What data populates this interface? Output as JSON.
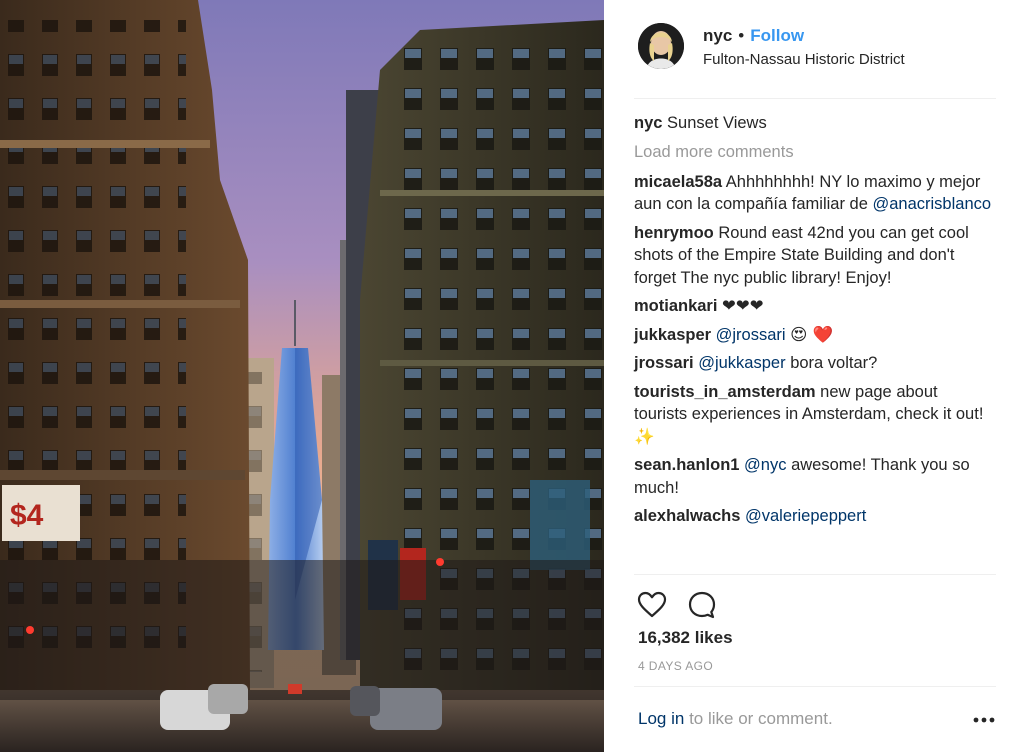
{
  "header": {
    "username": "nyc",
    "separator": "•",
    "follow_label": "Follow",
    "location": "Fulton-Nassau Historic District"
  },
  "caption": {
    "username": "nyc",
    "text": "Sunset Views"
  },
  "load_more": "Load more comments",
  "comments": [
    {
      "user": "micaela58a",
      "text": "Ahhhhhhhh! NY lo maximo y mejor aun con la compañía familiar de",
      "mention": "@anacrisblanco",
      "tail": ""
    },
    {
      "user": "henrymoo",
      "text": "Round east 42nd you can get cool shots of the Empire State Building and don't forget The nyc public library! Enjoy!",
      "mention": "",
      "tail": ""
    },
    {
      "user": "motiankari",
      "text": "❤❤❤",
      "mention": "",
      "tail": ""
    },
    {
      "user": "jukkasper",
      "text": "",
      "mention": "@jrossari",
      "tail": "😍 ❤️"
    },
    {
      "user": "jrossari",
      "text": "",
      "mention": "@jukkasper",
      "tail": "bora voltar?"
    },
    {
      "user": "tourists_in_amsterdam",
      "text": "new page about tourists experiences in Amsterdam, check it out! ✨",
      "mention": "",
      "tail": ""
    },
    {
      "user": "sean.hanlon1",
      "text": "",
      "mention": "@nyc",
      "tail": "awesome! Thank you so much!"
    },
    {
      "user": "alexhalwachs",
      "text": "",
      "mention": "@valeriepeppert",
      "tail": ""
    }
  ],
  "actions": {
    "like_icon": "heart-icon",
    "comment_icon": "comment-bubble-icon",
    "likes": "16,382 likes",
    "time": "4 DAYS AGO"
  },
  "login": {
    "link_label": "Log in",
    "rest": "to like or comment.",
    "more_icon": "more-dots-icon"
  },
  "colors": {
    "accent": "#3897f0",
    "mention": "#003569",
    "muted": "#999999",
    "text": "#262626"
  }
}
